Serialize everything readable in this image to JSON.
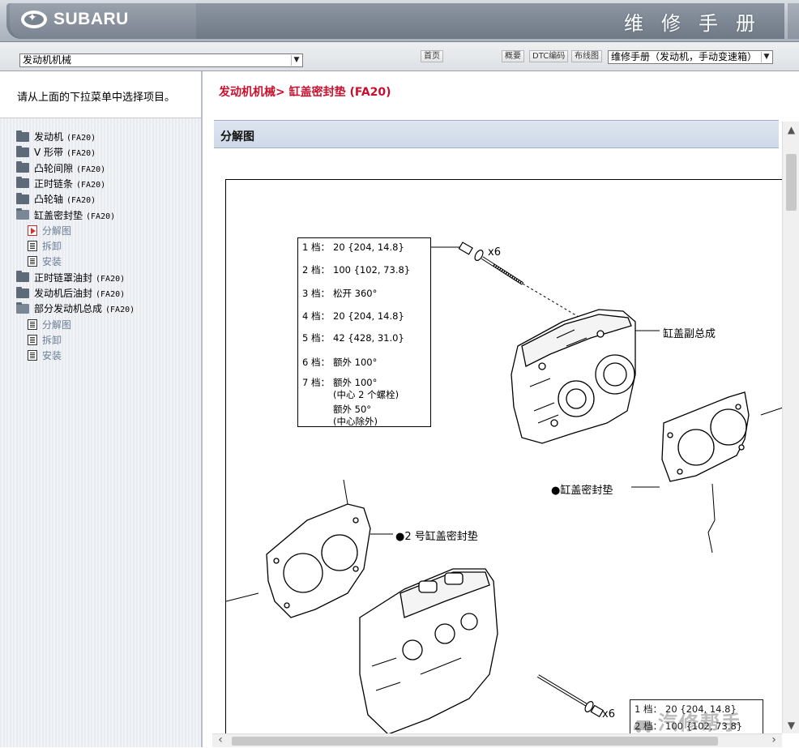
{
  "header": {
    "brand": "SUBARU",
    "title": "维修手册"
  },
  "toolbar": {
    "section_select_value": "发动机机械",
    "home_label": "首页",
    "overview_label": "概要",
    "dtc_label": "DTC编码",
    "wiring_label": "布线图",
    "manual_select_value": "维修手册（发动机，手动变速箱）"
  },
  "sidebar": {
    "hint": "请从上面的下拉菜单中选择项目。",
    "tree": [
      {
        "label": "发动机",
        "code": "(FA20)",
        "type": "folder"
      },
      {
        "label": "V 形带",
        "code": "(FA20)",
        "type": "folder"
      },
      {
        "label": "凸轮间隙",
        "code": "(FA20)",
        "type": "folder"
      },
      {
        "label": "正时链条",
        "code": "(FA20)",
        "type": "folder"
      },
      {
        "label": "凸轮轴",
        "code": "(FA20)",
        "type": "folder"
      },
      {
        "label": "缸盖密封垫",
        "code": "(FA20)",
        "type": "folder-open"
      },
      {
        "label": "分解图",
        "code": "",
        "type": "doc-active"
      },
      {
        "label": "拆卸",
        "code": "",
        "type": "doc"
      },
      {
        "label": "安装",
        "code": "",
        "type": "doc"
      },
      {
        "label": "正时链罩油封",
        "code": "(FA20)",
        "type": "folder"
      },
      {
        "label": "发动机后油封",
        "code": "(FA20)",
        "type": "folder"
      },
      {
        "label": "部分发动机总成",
        "code": "(FA20)",
        "type": "folder-open"
      },
      {
        "label": "分解图",
        "code": "",
        "type": "doc"
      },
      {
        "label": "拆卸",
        "code": "",
        "type": "doc"
      },
      {
        "label": "安装",
        "code": "",
        "type": "doc"
      }
    ]
  },
  "content": {
    "breadcrumb": "发动机机械> 缸盖密封垫 (FA20)",
    "section_title": "分解图",
    "torque_table": [
      {
        "step": "1 档：",
        "value": "20 {204, 14.8}"
      },
      {
        "step": "2 档：",
        "value": "100 {102, 73.8}"
      },
      {
        "step": "3 档：",
        "value": "松开 360°"
      },
      {
        "step": "4 档：",
        "value": "20 {204, 14.8}"
      },
      {
        "step": "5 档：",
        "value": "42 {428, 31.0}"
      },
      {
        "step": "6 档：",
        "value": "额外 100°"
      },
      {
        "step": "7 档：",
        "value": "额外 100°"
      },
      {
        "step": "",
        "value": "(中心 2 个螺栓)"
      },
      {
        "step": "",
        "value": "额外 50°"
      },
      {
        "step": "",
        "value": "(中心除外)"
      }
    ],
    "torque_table_2": [
      {
        "step": "1 档：",
        "value": "20 {204, 14.8}"
      },
      {
        "step": "2 档：",
        "value": "100 {102, 73.8}"
      }
    ],
    "callouts": {
      "bolt_qty_top": "x6",
      "bolt_qty_bottom": "x6",
      "sub_assembly": "缸盖副总成",
      "gasket": "●缸盖密封垫",
      "gasket_no2": "●2 号缸盖密封垫"
    },
    "watermark": "汽修帮手"
  }
}
